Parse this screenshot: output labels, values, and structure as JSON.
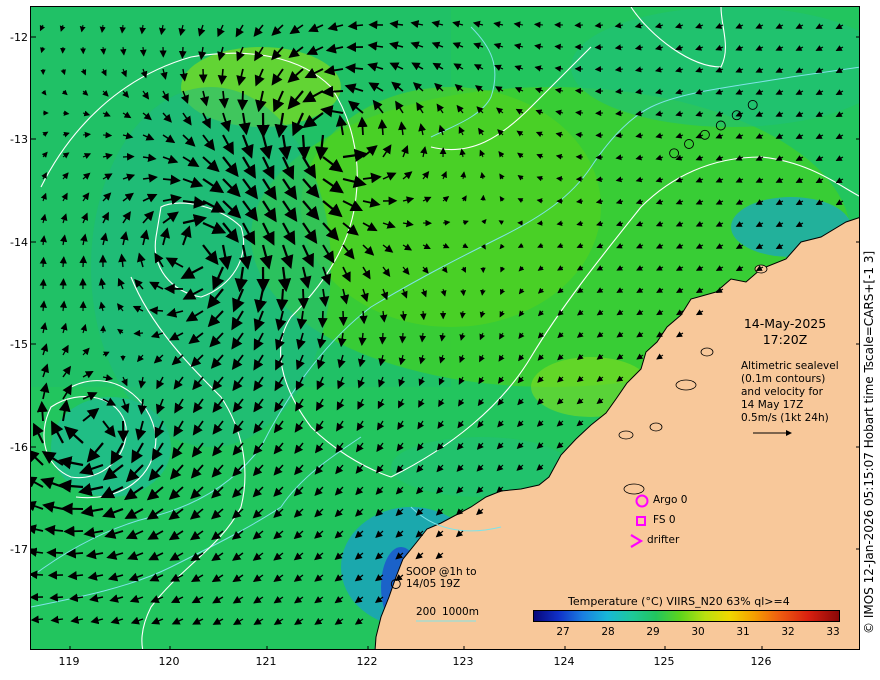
{
  "map": {
    "lat_ticks": [
      "-12",
      "-13",
      "-14",
      "-15",
      "-16",
      "-17"
    ],
    "lon_ticks": [
      "119",
      "120",
      "121",
      "122",
      "123",
      "124",
      "125",
      "126"
    ],
    "lat_range": [
      -17.95,
      -11.7
    ],
    "lon_range": [
      118.6,
      126.95
    ],
    "date": "14-May-2025",
    "time": "17:20Z",
    "altimetry_lines": [
      "Altimetric sealevel",
      "(0.1m contours)",
      "and velocity for",
      "14 May 17Z",
      "0.5m/s (1kt 24h)"
    ],
    "legend": {
      "argo": "Argo 0",
      "fs": "FS 0",
      "drifter": "drifter"
    },
    "soop_lines": [
      "SOOP @1h to",
      "14/05 19Z"
    ],
    "depth_200": "200",
    "depth_1000": "1000m",
    "colorbar": {
      "title": "Temperature (°C) VIIRS_N20 63% ql>=4",
      "ticks": [
        "27",
        "28",
        "29",
        "30",
        "31",
        "32",
        "33"
      ],
      "range": [
        26.3,
        33.1
      ]
    },
    "side_credit": "© IMOS 12-Jan-2026 05:15:07 Hobart time Tscale=CARS+[-1 3]",
    "colors": {
      "land": "#f8c89a",
      "coast": "#000000",
      "contour": "#ffffff",
      "isobath": "#7fe3e8",
      "marker": "#ff00ff"
    },
    "soop_track_points": [
      {
        "lon": 125.07,
        "lat": -13.12
      },
      {
        "lon": 125.22,
        "lat": -13.03
      },
      {
        "lon": 125.38,
        "lat": -12.94
      },
      {
        "lon": 125.54,
        "lat": -12.85
      },
      {
        "lon": 125.7,
        "lat": -12.75
      },
      {
        "lon": 125.86,
        "lat": -12.65
      },
      {
        "lon": 122.27,
        "lat": -17.3
      }
    ]
  }
}
